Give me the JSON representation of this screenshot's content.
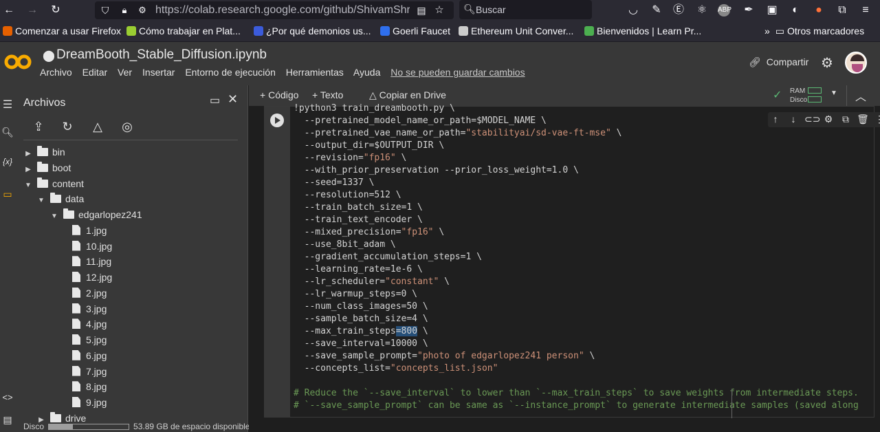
{
  "browser": {
    "url": "https://colab.research.google.com/github/ShivamShrira",
    "search_label": "Buscar"
  },
  "bookmarks": [
    {
      "label": "Comenzar a usar Firefox",
      "color": "#e66000"
    },
    {
      "label": "Cómo trabajar en Plat...",
      "color": "#9acd32"
    },
    {
      "label": "¿Por qué demonios us...",
      "color": "#3b5bdb"
    },
    {
      "label": "Goerli Faucet",
      "color": "#2f6fed"
    },
    {
      "label": "Ethereum Unit Conver...",
      "color": "#cccccc"
    },
    {
      "label": "Bienvenidos | Learn Pr...",
      "color": "#4caf50"
    }
  ],
  "bookmarks_more": "Otros marcadores",
  "colab": {
    "title": "DreamBooth_Stable_Diffusion.ipynb",
    "menu": [
      "Archivo",
      "Editar",
      "Ver",
      "Insertar",
      "Entorno de ejecución",
      "Herramientas",
      "Ayuda"
    ],
    "warning": "No se pueden guardar cambios",
    "share": "Compartir"
  },
  "files": {
    "title": "Archivos",
    "tree": [
      {
        "label": "bin",
        "type": "folder",
        "depth": 0,
        "expanded": false
      },
      {
        "label": "boot",
        "type": "folder",
        "depth": 0,
        "expanded": false
      },
      {
        "label": "content",
        "type": "folder",
        "depth": 0,
        "expanded": true
      },
      {
        "label": "data",
        "type": "folder",
        "depth": 1,
        "expanded": true
      },
      {
        "label": "edgarlopez241",
        "type": "folder",
        "depth": 2,
        "expanded": true
      },
      {
        "label": "1.jpg",
        "type": "file",
        "depth": 3
      },
      {
        "label": "10.jpg",
        "type": "file",
        "depth": 3
      },
      {
        "label": "11.jpg",
        "type": "file",
        "depth": 3
      },
      {
        "label": "12.jpg",
        "type": "file",
        "depth": 3
      },
      {
        "label": "2.jpg",
        "type": "file",
        "depth": 3
      },
      {
        "label": "3.jpg",
        "type": "file",
        "depth": 3
      },
      {
        "label": "4.jpg",
        "type": "file",
        "depth": 3
      },
      {
        "label": "5.jpg",
        "type": "file",
        "depth": 3
      },
      {
        "label": "6.jpg",
        "type": "file",
        "depth": 3
      },
      {
        "label": "7.jpg",
        "type": "file",
        "depth": 3
      },
      {
        "label": "8.jpg",
        "type": "file",
        "depth": 3
      },
      {
        "label": "9.jpg",
        "type": "file",
        "depth": 3
      },
      {
        "label": "drive",
        "type": "folder",
        "depth": 1,
        "expanded": false
      }
    ],
    "disk_label": "Disco",
    "disk_used_fraction": 0.3,
    "disk_free": "53.89 GB de espacio disponible"
  },
  "nb_toolbar": {
    "code": "Código",
    "text": "Texto",
    "copy": "Copiar en Drive",
    "ram": "RAM",
    "disk": "Disco"
  },
  "code_lines": [
    "!python3 train_dreambooth.py \\",
    "  --pretrained_model_name_or_path=$MODEL_NAME \\",
    "  --pretrained_vae_name_or_path=\"stabilityai/sd-vae-ft-mse\" \\",
    "  --output_dir=$OUTPUT_DIR \\",
    "  --revision=\"fp16\" \\",
    "  --with_prior_preservation --prior_loss_weight=1.0 \\",
    "  --seed=1337 \\",
    "  --resolution=512 \\",
    "  --train_batch_size=1 \\",
    "  --train_text_encoder \\",
    "  --mixed_precision=\"fp16\" \\",
    "  --use_8bit_adam \\",
    "  --gradient_accumulation_steps=1 \\",
    "  --learning_rate=1e-6 \\",
    "  --lr_scheduler=\"constant\" \\",
    "  --lr_warmup_steps=0 \\",
    "  --num_class_images=50 \\",
    "  --sample_batch_size=4 \\",
    "  --max_train_steps=800 \\",
    "  --save_interval=10000 \\",
    "  --save_sample_prompt=\"photo of edgarlopez241 person\" \\",
    "  --concepts_list=\"concepts_list.json\"",
    "",
    "# Reduce the `--save_interval` to lower than `--max_train_steps` to save weights from intermediate steps.",
    "# `--save_sample_prompt` can be same as `--instance_prompt` to generate intermediate samples (saved along"
  ],
  "icons": {
    "back": "arrow-left-icon",
    "forward": "arrow-right-icon",
    "reload": "reload-icon",
    "share": "link-icon",
    "settings": "gear-icon",
    "run": "play-icon"
  }
}
